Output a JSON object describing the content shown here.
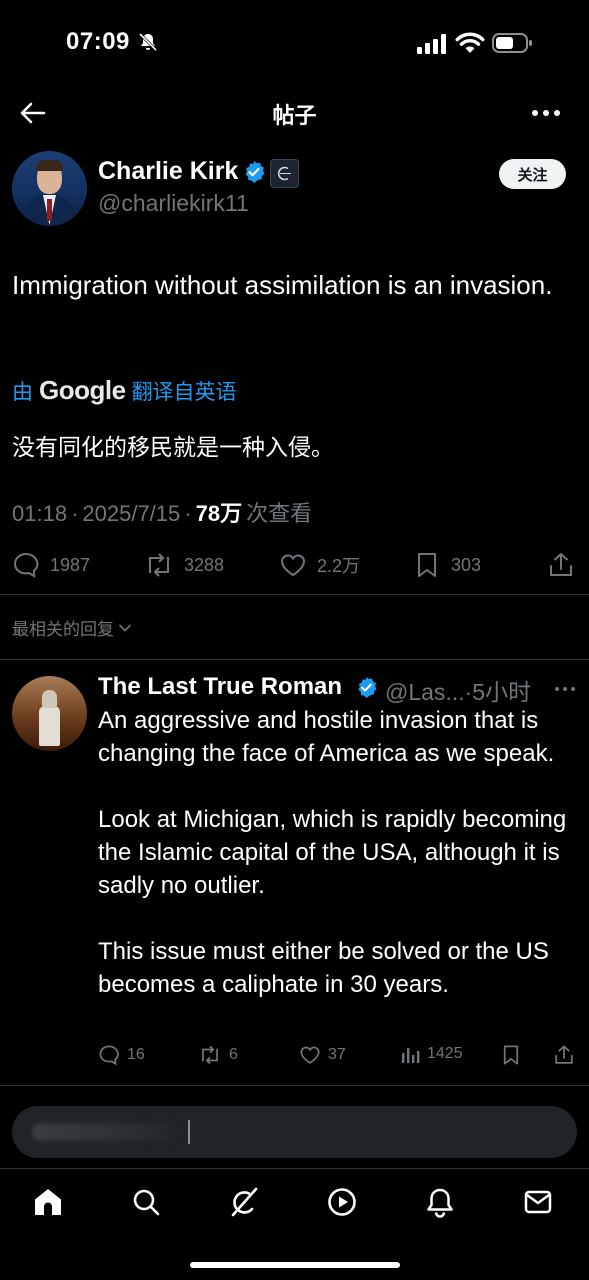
{
  "status_bar": {
    "time": "07:09"
  },
  "header": {
    "title": "帖子"
  },
  "post": {
    "author_name": "Charlie Kirk",
    "author_handle": "@charliekirk11",
    "follow_label": "关注",
    "text": "Immigration without assimilation is an invasion.",
    "translation": {
      "prefix": "由",
      "provider": "Google",
      "suffix": "翻译自英语",
      "text": "没有同化的移民就是一种入侵。"
    },
    "meta": {
      "time": "01:18",
      "separator": "·",
      "date": "2025/7/15",
      "views_count": "78万",
      "views_label": "次查看"
    },
    "stats": {
      "replies": "1987",
      "reposts": "3288",
      "likes": "2.2万",
      "bookmarks": "303"
    }
  },
  "replies_sort": {
    "label": "最相关的回复"
  },
  "reply": {
    "author_name": "The Last True Roman",
    "author_handle": "@Las...",
    "separator": "·",
    "time_ago": "5小时",
    "paragraphs": [
      "An aggressive and hostile invasion that is changing the face of America as we speak.",
      "Look at Michigan, which is rapidly becoming the Islamic capital of the USA, although it is sadly no outlier.",
      "This issue must either be solved or the US becomes a caliphate in 30 years."
    ],
    "stats": {
      "replies": "16",
      "reposts": "6",
      "likes": "37",
      "views": "1425"
    }
  },
  "colors": {
    "background": "#000000",
    "text": "#e7e9ea",
    "secondary": "#71767b",
    "accent": "#1d9bf0",
    "divider": "#2f3336"
  },
  "icons": {
    "tabs": [
      "home-icon",
      "search-icon",
      "grok-icon",
      "video-icon",
      "notifications-icon",
      "messages-icon"
    ]
  }
}
